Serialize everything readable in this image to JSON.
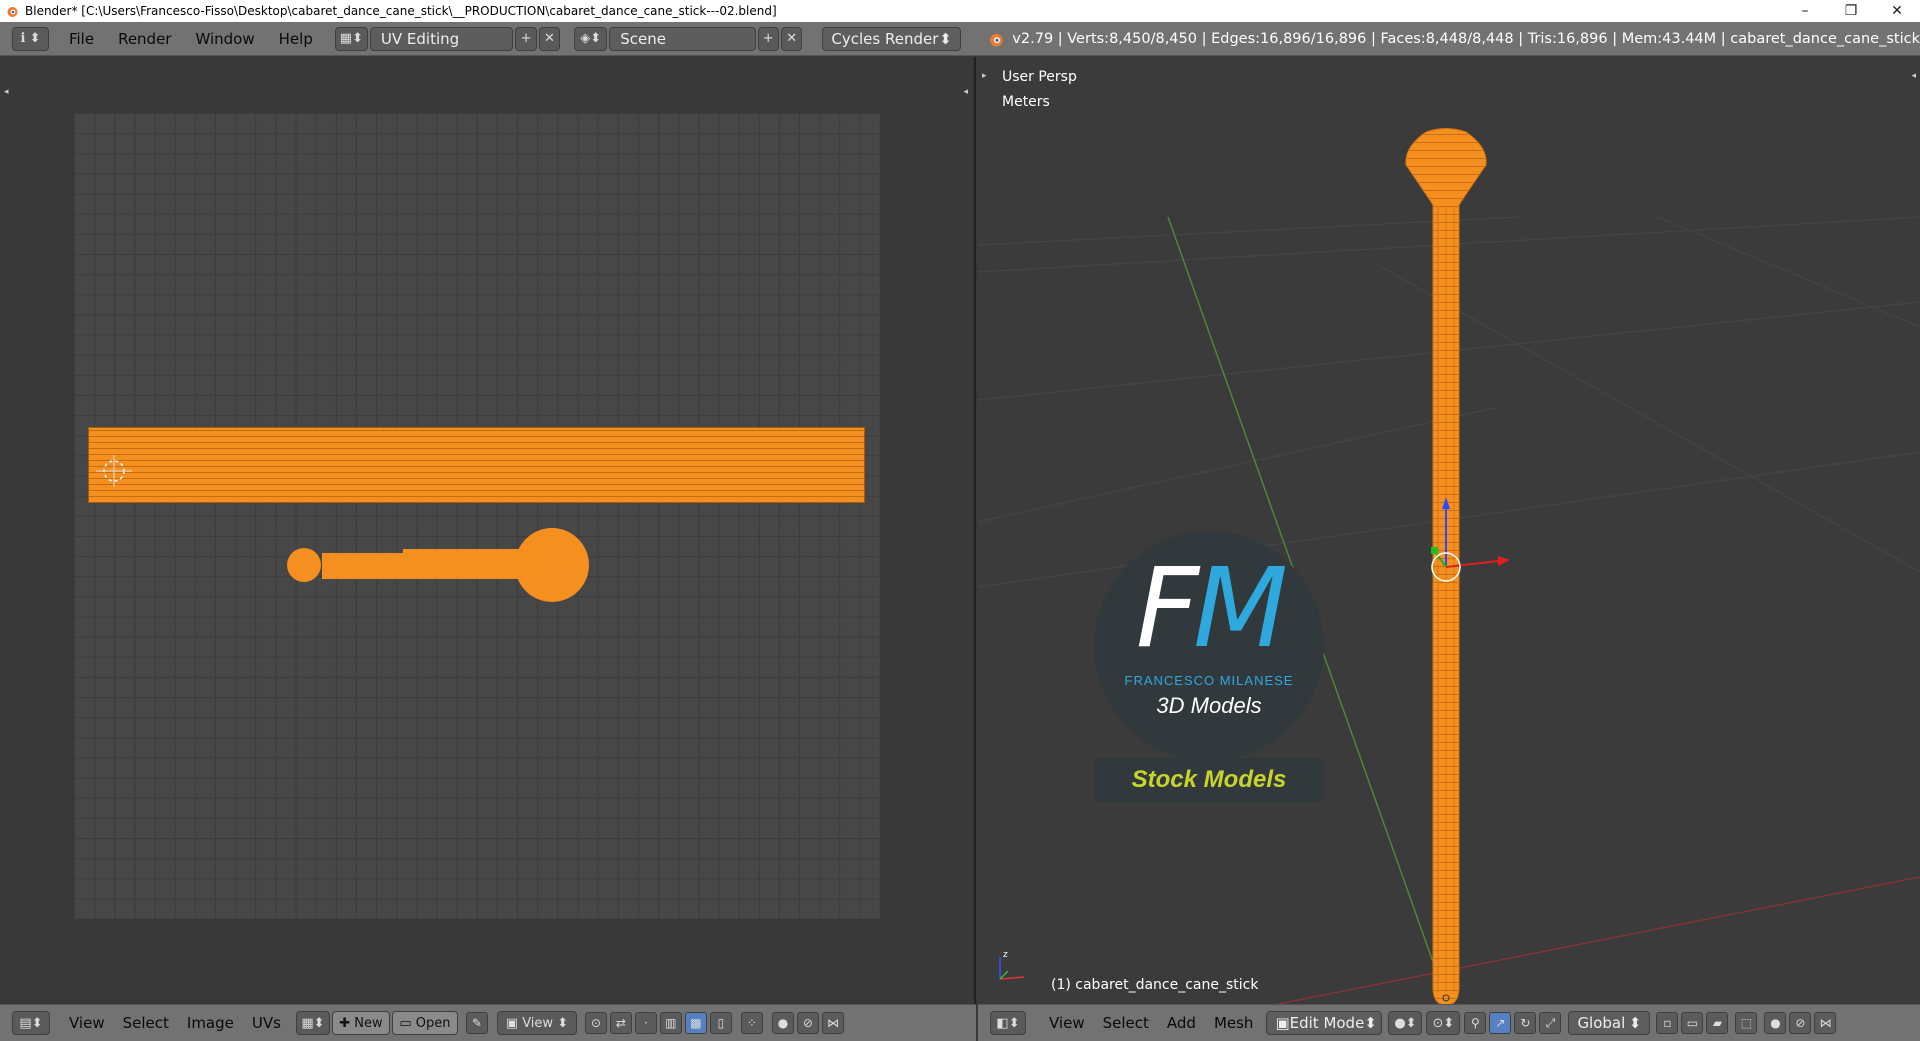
{
  "window": {
    "title": "Blender* [C:\\Users\\Francesco-Fisso\\Desktop\\cabaret_dance_cane_stick\\__PRODUCTION\\cabaret_dance_cane_stick---02.blend]",
    "minimize": "–",
    "maximize": "❐",
    "close": "✕"
  },
  "header": {
    "info_icon": "ℹ",
    "menus": [
      "File",
      "Render",
      "Window",
      "Help"
    ],
    "screen_layout": "UV Editing",
    "scene": "Scene",
    "render_engine": "Cycles Render",
    "stats": "v2.79 | Verts:8,450/8,450 | Edges:16,896/16,896 | Faces:8,448/8,448 | Tris:16,896 | Mem:43.44M | cabaret_dance_cane_stick",
    "add_symbol": "+",
    "remove_symbol": "✕"
  },
  "uv_editor": {
    "menus": [
      "View",
      "Select",
      "Image",
      "UVs"
    ],
    "new_label": "New",
    "open_label": "Open",
    "view_label": "View"
  },
  "viewport": {
    "view_name": "User Persp",
    "units": "Meters",
    "object_label": "(1) cabaret_dance_cane_stick",
    "menus": [
      "View",
      "Select",
      "Add",
      "Mesh"
    ],
    "mode": "Edit Mode",
    "orientation": "Global"
  },
  "watermark": {
    "letter_f": "F",
    "letter_m": "M",
    "name": "FRANCESCO MILANESE",
    "tagline": "3D Models",
    "banner": "Stock Models"
  },
  "colors": {
    "mesh": "#f58f1f",
    "header": "#727272",
    "viewport_bg": "#3b3b3b",
    "watermark_blue": "#2fa8dd",
    "watermark_yellow": "#c8d42a"
  }
}
